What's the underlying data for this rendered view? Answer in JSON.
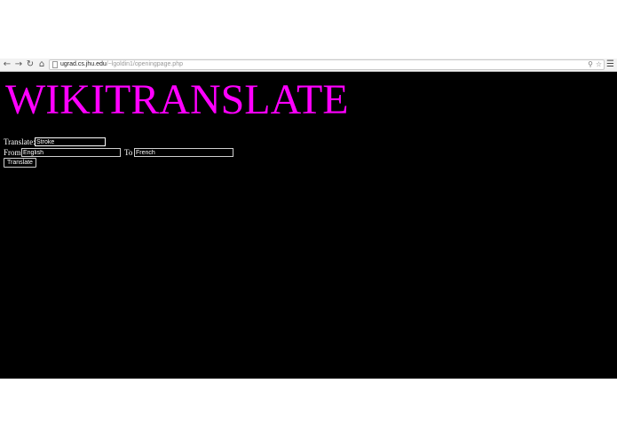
{
  "browser": {
    "url_host": "ugrad.cs.jhu.edu",
    "url_path": "/~lgoldin1/openingpage.php",
    "icons": {
      "back": "back-arrow-icon",
      "forward": "forward-arrow-icon",
      "reload": "reload-icon",
      "home": "home-icon",
      "page": "page-icon",
      "zoom": "zoom-icon",
      "star": "star-icon",
      "menu": "menu-icon"
    }
  },
  "page": {
    "title": "WIKITRANSLATE",
    "title_color": "#ff00ff",
    "background_color": "#000000",
    "form": {
      "translate_label": "Translate:",
      "translate_value": "Stroke",
      "from_label": "From",
      "from_value": "English",
      "to_label": "To",
      "to_value": "French",
      "submit_label": "Translate"
    }
  }
}
